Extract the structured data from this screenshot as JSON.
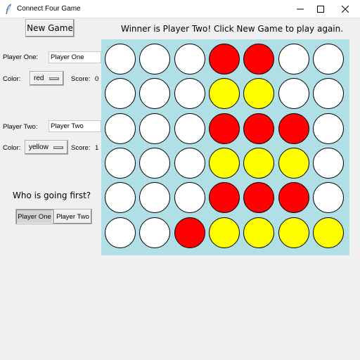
{
  "window": {
    "title": "Connect Four Game"
  },
  "toolbar": {
    "new_game_label": "New Game"
  },
  "status": {
    "message": "Winner is Player Two!  Click New Game to play again."
  },
  "player_one": {
    "label": "Player One:",
    "name_value": "Player One",
    "color_label": "Color:",
    "color_value": "red",
    "score_label": "Score:",
    "score_value": "0"
  },
  "player_two": {
    "label": "Player Two:",
    "name_value": "Player Two",
    "color_label": "Color:",
    "color_value": "yellow",
    "score_label": "Score:",
    "score_value": "1"
  },
  "first_player": {
    "prompt": "Who is going first?",
    "options": [
      "Player One",
      "Player Two"
    ],
    "selected": "Player One"
  },
  "colors": {
    "red": "#ff0000",
    "yellow": "#ffff00",
    "empty": "#ffffff",
    "board_background": "#b0e0e6"
  },
  "board": {
    "rows": 6,
    "columns": 7,
    "cells": [
      [
        "empty",
        "empty",
        "empty",
        "red",
        "red",
        "empty",
        "empty"
      ],
      [
        "empty",
        "empty",
        "empty",
        "yellow",
        "yellow",
        "empty",
        "empty"
      ],
      [
        "empty",
        "empty",
        "empty",
        "red",
        "red",
        "red",
        "empty"
      ],
      [
        "empty",
        "empty",
        "empty",
        "yellow",
        "yellow",
        "yellow",
        "empty"
      ],
      [
        "empty",
        "empty",
        "empty",
        "red",
        "red",
        "red",
        "empty"
      ],
      [
        "empty",
        "empty",
        "red",
        "yellow",
        "yellow",
        "yellow",
        "yellow"
      ]
    ]
  }
}
